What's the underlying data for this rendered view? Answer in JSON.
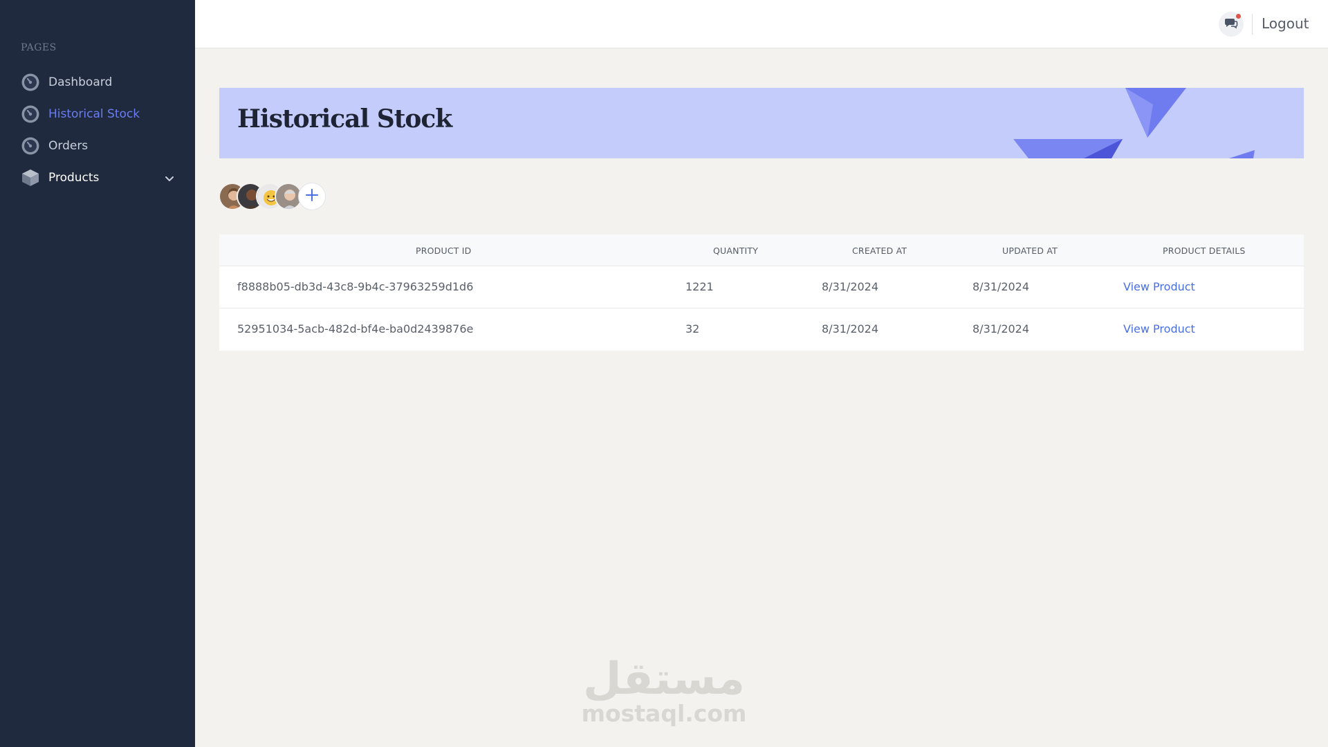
{
  "sidebar": {
    "section_title": "PAGES",
    "items": [
      {
        "label": "Dashboard",
        "icon": "dashboard-icon",
        "active": false
      },
      {
        "label": "Historical Stock",
        "icon": "dashboard-icon",
        "active": true
      },
      {
        "label": "Orders",
        "icon": "dashboard-icon",
        "active": false
      },
      {
        "label": "Products",
        "icon": "cube-icon",
        "active": false,
        "expandable": true
      }
    ]
  },
  "topbar": {
    "chat_icon": "chat-icon",
    "logout_label": "Logout"
  },
  "banner": {
    "title": "Historical Stock"
  },
  "avatars": {
    "add_icon": "plus-icon"
  },
  "table": {
    "headers": [
      "PRODUCT ID",
      "QUANTITY",
      "CREATED AT",
      "UPDATED AT",
      "PRODUCT DETAILS"
    ],
    "rows": [
      {
        "product_id": "f8888b05-db3d-43c8-9b4c-37963259d1d6",
        "quantity": "1221",
        "created_at": "8/31/2024",
        "updated_at": "8/31/2024",
        "details": "View Product"
      },
      {
        "product_id": "52951034-5acb-482d-bf4e-ba0d2439876e",
        "quantity": "32",
        "created_at": "8/31/2024",
        "updated_at": "8/31/2024",
        "details": "View Product"
      }
    ]
  },
  "watermark": {
    "arabic": "مستقل",
    "latin": "mostaql.com"
  },
  "colors": {
    "sidebar_bg": "#1f2a3f",
    "accent": "#6b7df0",
    "banner_bg": "#c4ccfb",
    "link": "#4a6fe3",
    "page_bg": "#f3f2ee"
  }
}
